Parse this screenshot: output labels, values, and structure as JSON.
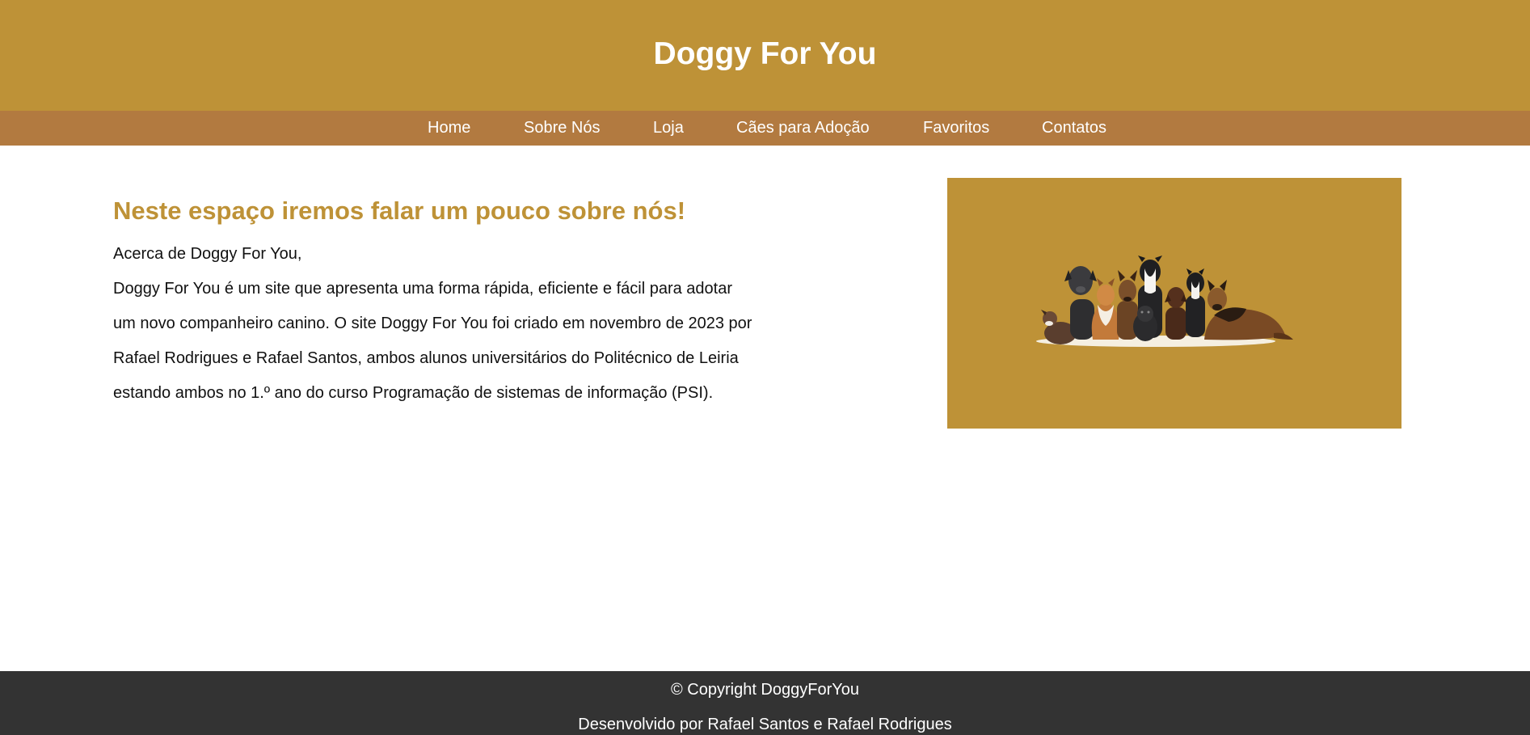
{
  "header": {
    "title": "Doggy For You"
  },
  "nav": {
    "items": [
      {
        "label": "Home"
      },
      {
        "label": "Sobre Nós"
      },
      {
        "label": "Loja"
      },
      {
        "label": "Cães para Adoção"
      },
      {
        "label": "Favoritos"
      },
      {
        "label": "Contatos"
      }
    ]
  },
  "about": {
    "heading": "Neste espaço iremos falar um pouco sobre nós!",
    "intro": "Acerca de Doggy For You,",
    "lines": [
      "Doggy For You é um site que apresenta uma forma rápida, eficiente e fácil para adotar",
      "um novo companheiro canino. O site Doggy For You foi criado em novembro de 2023 por",
      "Rafael Rodrigues e Rafael Santos, ambos alunos universitários do Politécnico de Leiria",
      "estando ambos no 1.º ano do curso Programação de sistemas de informação (PSI)."
    ]
  },
  "footer": {
    "copyright": "© Copyright DoggyForYou",
    "credits": "Desenvolvido por Rafael Santos e Rafael Rodrigues"
  },
  "colors": {
    "brand_gold": "#be9237",
    "nav_brown": "#b27a40",
    "footer_dark": "#333333"
  }
}
